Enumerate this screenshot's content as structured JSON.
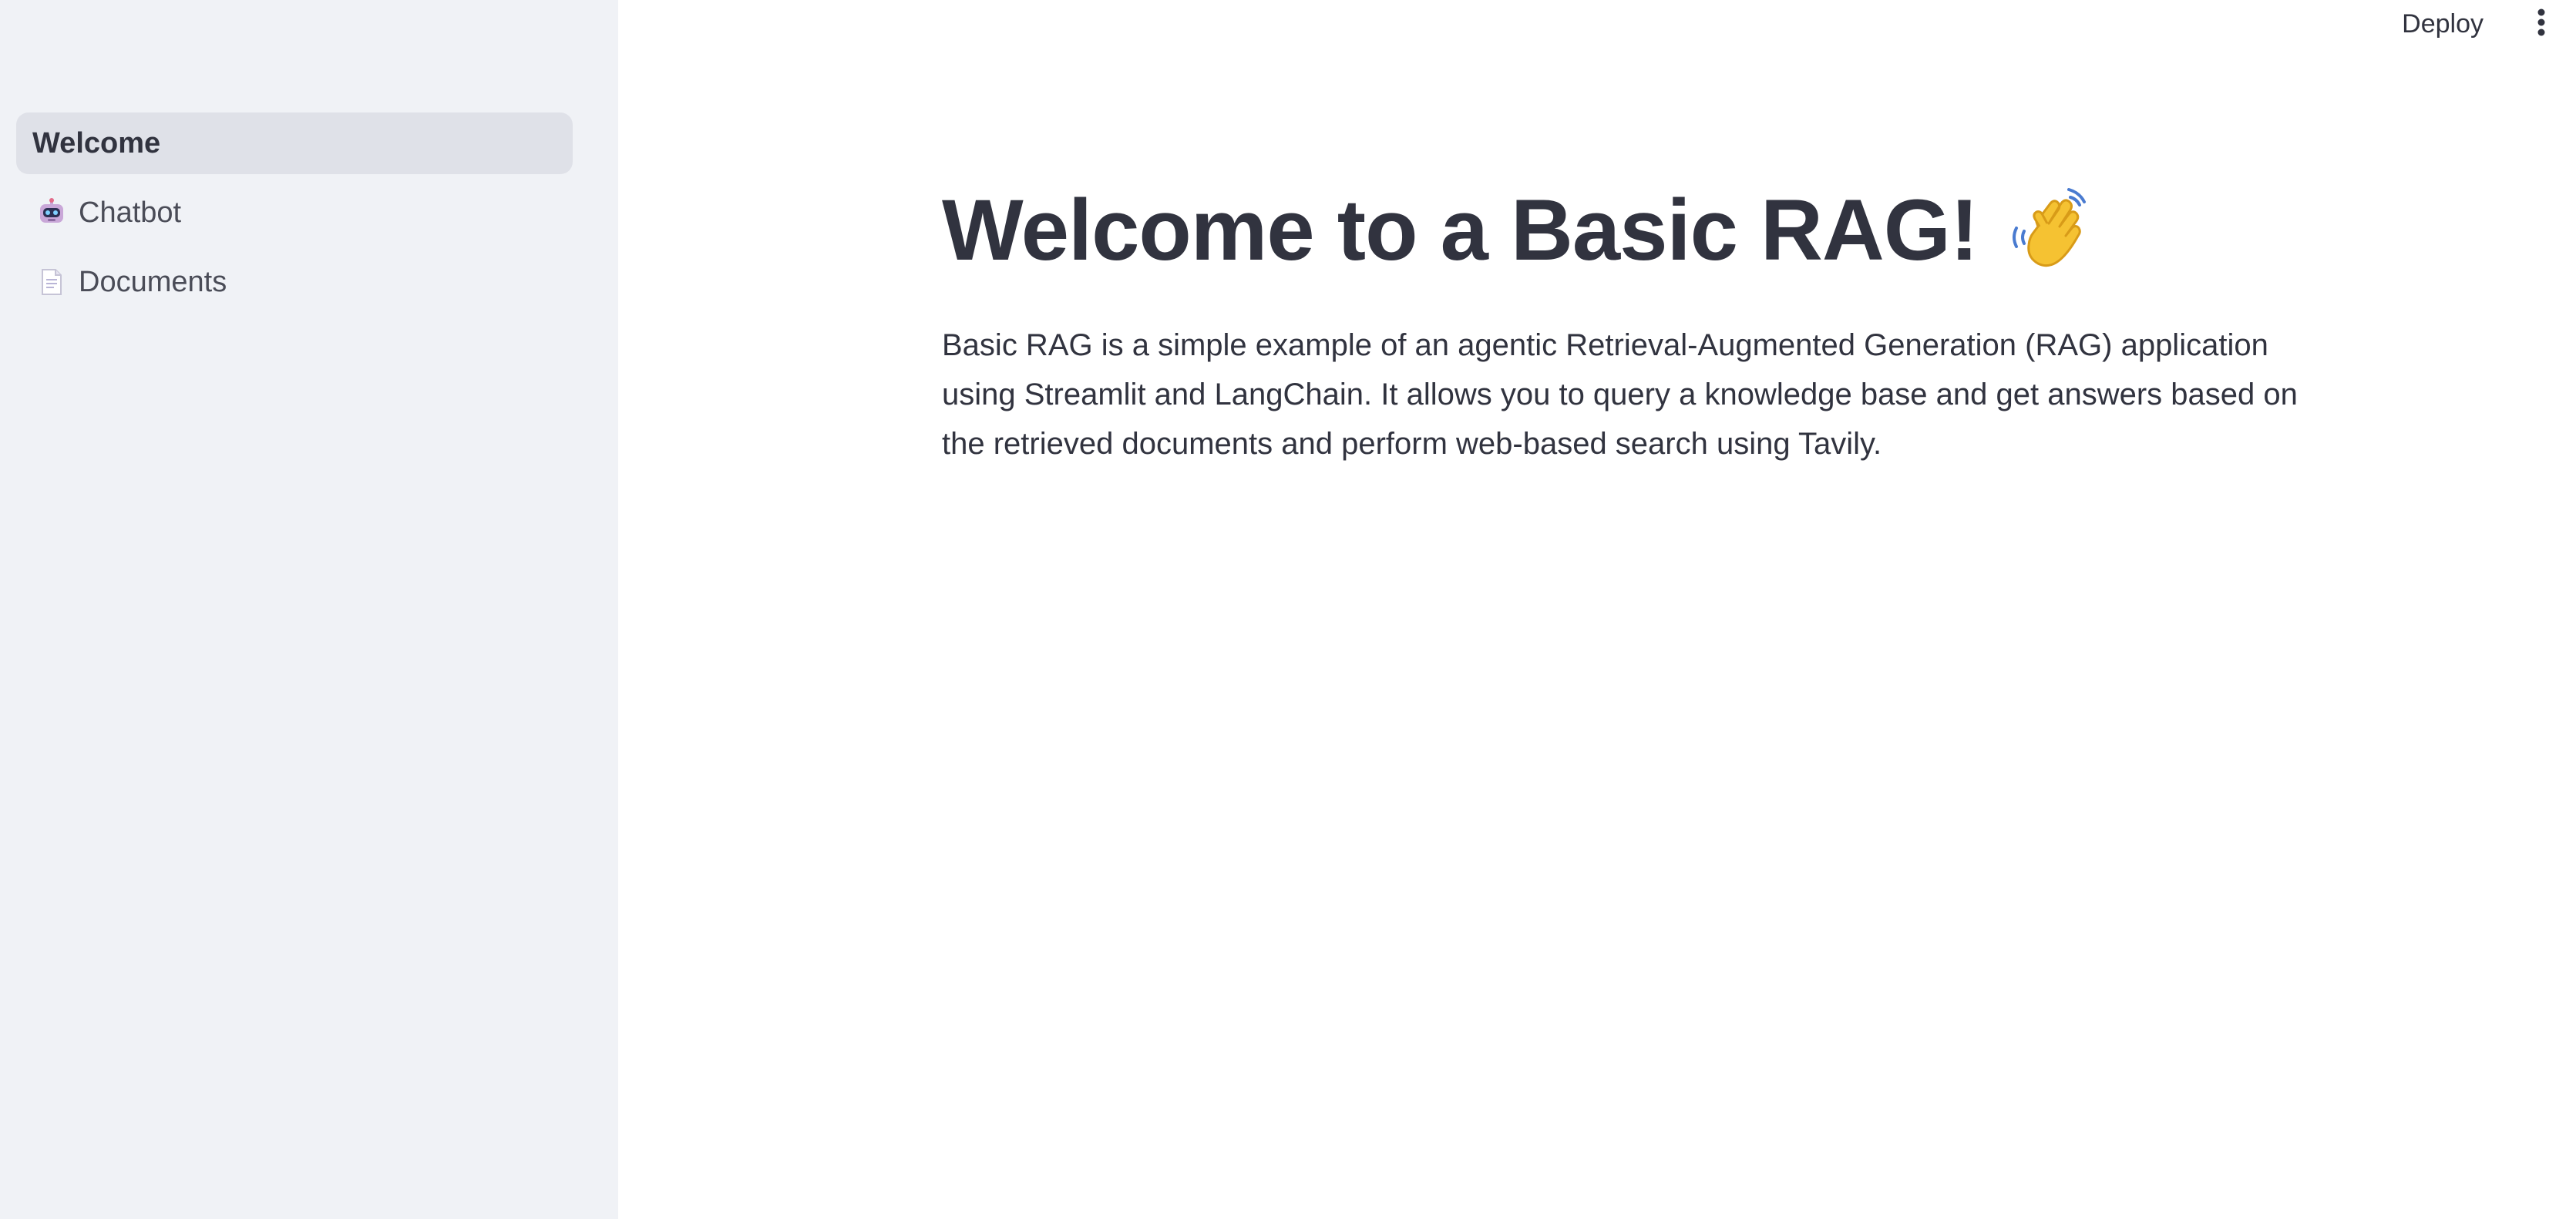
{
  "sidebar": {
    "items": [
      {
        "label": "Welcome",
        "icon": "",
        "active": true
      },
      {
        "label": "Chatbot",
        "icon": "robot-icon",
        "active": false
      },
      {
        "label": "Documents",
        "icon": "page-icon",
        "active": false
      }
    ]
  },
  "header": {
    "deploy_label": "Deploy",
    "menu_icon": "vertical-dots-icon"
  },
  "main": {
    "title": "Welcome to a Basic RAG!",
    "title_icon": "waving-hand-icon",
    "description": "Basic RAG is a simple example of an agentic Retrieval-Augmented Generation (RAG) application using Streamlit and LangChain. It allows you to query a knowledge base and get answers based on the retrieved documents and perform web-based search using Tavily."
  },
  "colors": {
    "sidebar_bg": "#f0f2f6",
    "active_item_bg": "#dfe1e8",
    "text": "#31333f",
    "wave_hand": "#f5c232"
  }
}
